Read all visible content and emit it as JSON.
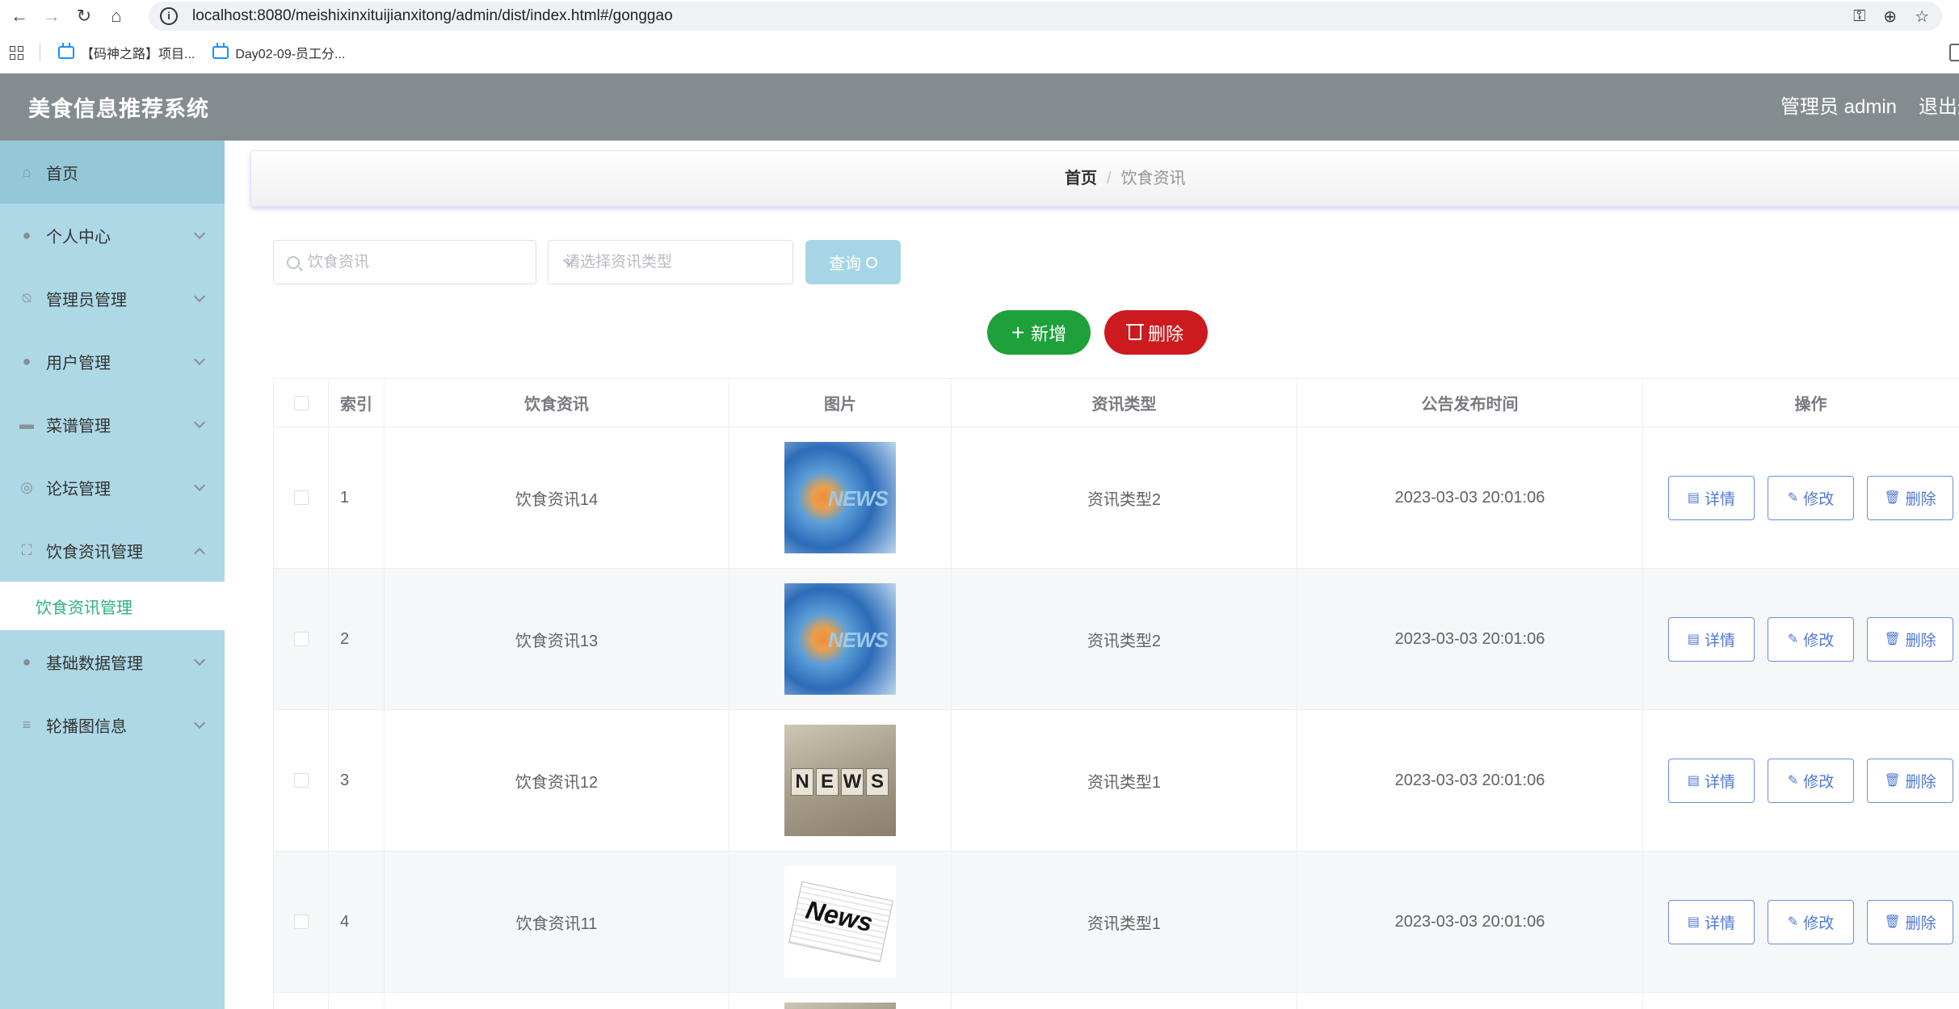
{
  "browser": {
    "url": "localhost:8080/meishixinxituijianxitong/admin/dist/index.html#/gonggao",
    "bookmarks": [
      "【码神之路】项目...",
      "Day02-09-员工分..."
    ]
  },
  "header": {
    "title": "美食信息推荐系统",
    "user": "管理员 admin",
    "logout": "退出登录"
  },
  "sidebar": {
    "items": [
      {
        "label": "首页",
        "icon": "home-icon"
      },
      {
        "label": "个人中心",
        "icon": "user-icon"
      },
      {
        "label": "管理员管理",
        "icon": "bell-off-icon"
      },
      {
        "label": "用户管理",
        "icon": "balloon-icon"
      },
      {
        "label": "菜谱管理",
        "icon": "ticket-icon"
      },
      {
        "label": "论坛管理",
        "icon": "compass-icon"
      },
      {
        "label": "饮食资讯管理",
        "icon": "full-screen-icon"
      },
      {
        "label": "基础数据管理",
        "icon": "user-solid-icon"
      },
      {
        "label": "轮播图信息",
        "icon": "menu-icon"
      }
    ],
    "submenu_active": "饮食资讯管理"
  },
  "breadcrumb": {
    "home": "首页",
    "separator": "/",
    "current": "饮食资讯"
  },
  "search": {
    "placeholder": "饮食资讯",
    "type_placeholder": "请选择资讯类型",
    "query_label": "查询"
  },
  "actions": {
    "add_label": "新增",
    "delete_label": "删除"
  },
  "table": {
    "headers": [
      "索引",
      "饮食资讯",
      "图片",
      "资讯类型",
      "公告发布时间",
      "操作"
    ],
    "op_labels": {
      "detail": "详情",
      "edit": "修改",
      "delete": "删除"
    },
    "rows": [
      {
        "index": "1",
        "title": "饮食资讯14",
        "type": "资讯类型2",
        "time": "2023-03-03 20:01:06"
      },
      {
        "index": "2",
        "title": "饮食资讯13",
        "type": "资讯类型2",
        "time": "2023-03-03 20:01:06"
      },
      {
        "index": "3",
        "title": "饮食资讯12",
        "type": "资讯类型1",
        "time": "2023-03-03 20:01:06"
      },
      {
        "index": "4",
        "title": "饮食资讯11",
        "type": "资讯类型1",
        "time": "2023-03-03 20:01:06"
      }
    ]
  },
  "colors": {
    "header_bg": "#858c90",
    "sidebar_bg": "#add8e6",
    "add_btn": "#1ea13a",
    "delete_btn": "#cd1a1f",
    "active_submenu": "#2db37a"
  }
}
